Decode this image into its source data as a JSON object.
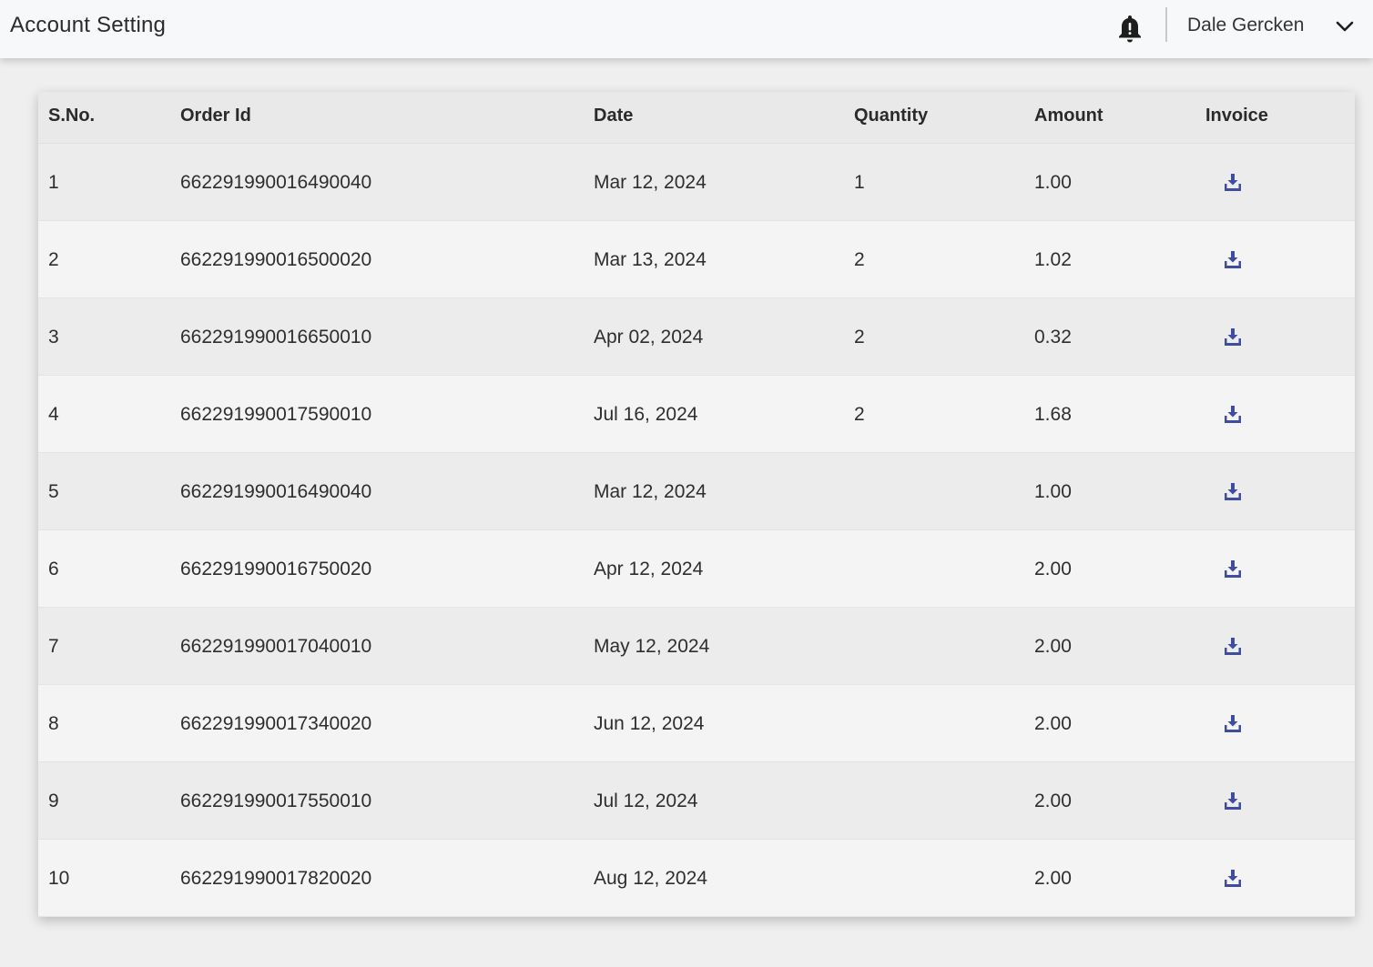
{
  "header": {
    "title": "Account Setting",
    "user_name": "Dale Gercken",
    "bell_icon": "bell-alert-icon",
    "chevron_icon": "chevron-down-icon"
  },
  "colors": {
    "accent": "#3f4da1"
  },
  "table": {
    "columns": [
      "S.No.",
      "Order Id",
      "Date",
      "Quantity",
      "Amount",
      "Invoice"
    ],
    "rows": [
      {
        "sno": "1",
        "order_id": "662291990016490040",
        "date": "Mar 12, 2024",
        "quantity": "1",
        "amount": "1.00",
        "invoice_icon": "download-icon"
      },
      {
        "sno": "2",
        "order_id": "662291990016500020",
        "date": "Mar 13, 2024",
        "quantity": "2",
        "amount": "1.02",
        "invoice_icon": "download-icon"
      },
      {
        "sno": "3",
        "order_id": "662291990016650010",
        "date": "Apr 02, 2024",
        "quantity": "2",
        "amount": "0.32",
        "invoice_icon": "download-icon"
      },
      {
        "sno": "4",
        "order_id": "662291990017590010",
        "date": "Jul 16, 2024",
        "quantity": "2",
        "amount": "1.68",
        "invoice_icon": "download-icon"
      },
      {
        "sno": "5",
        "order_id": "662291990016490040",
        "date": "Mar 12, 2024",
        "quantity": "",
        "amount": "1.00",
        "invoice_icon": "download-icon"
      },
      {
        "sno": "6",
        "order_id": "662291990016750020",
        "date": "Apr 12, 2024",
        "quantity": "",
        "amount": "2.00",
        "invoice_icon": "download-icon"
      },
      {
        "sno": "7",
        "order_id": "662291990017040010",
        "date": "May 12, 2024",
        "quantity": "",
        "amount": "2.00",
        "invoice_icon": "download-icon"
      },
      {
        "sno": "8",
        "order_id": "662291990017340020",
        "date": "Jun 12, 2024",
        "quantity": "",
        "amount": "2.00",
        "invoice_icon": "download-icon"
      },
      {
        "sno": "9",
        "order_id": "662291990017550010",
        "date": "Jul 12, 2024",
        "quantity": "",
        "amount": "2.00",
        "invoice_icon": "download-icon"
      },
      {
        "sno": "10",
        "order_id": "662291990017820020",
        "date": "Aug 12, 2024",
        "quantity": "",
        "amount": "2.00",
        "invoice_icon": "download-icon"
      }
    ]
  }
}
